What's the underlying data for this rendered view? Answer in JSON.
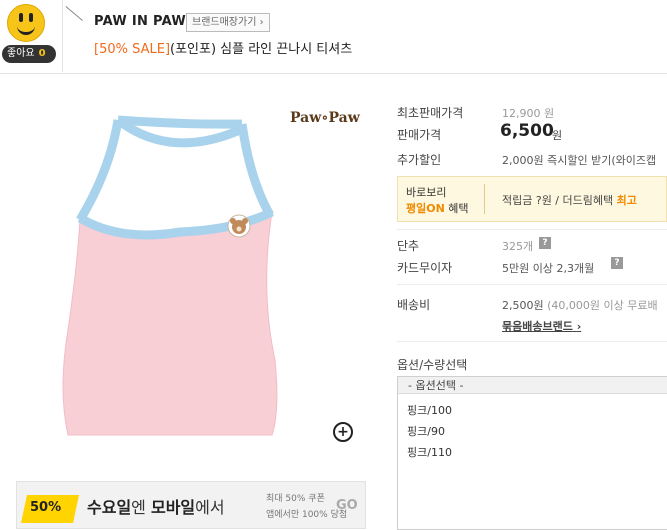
{
  "header": {
    "like_label": "좋아요",
    "like_count": "0",
    "brand": "PAW IN PAW",
    "brand_store_button": "브랜드매장가기 ›",
    "title_sale": "[50% SALE]",
    "title_rest": "(포인포) 심플 라인 끈나시 티셔츠"
  },
  "product_image": {
    "logo_text": "Paw∘Paw",
    "zoom_icon": "+"
  },
  "banner": {
    "tag": "50%",
    "main_pre": "수요일",
    "main_mid": "엔 ",
    "main_bold": "모바일",
    "main_post": "에서",
    "sub1": "최대 50% 쿠폰",
    "sub2": "앱에서만 100% 당첨",
    "go": "GO"
  },
  "info": {
    "first_price_label": "최초판매가격",
    "first_price_value": "12,900 원",
    "price_label": "판매가격",
    "price_value": "6,500",
    "price_unit": "원",
    "extra_discount_label": "추가할인",
    "extra_discount_value": "2,000원 즉시할인 받기(와이즈캡",
    "promo_line1": "바로보리",
    "promo_on": "평일ON",
    "promo_on_suffix": " 혜택",
    "promo_right_pre": "적립금 ?원 / 더드림혜택 ",
    "promo_right_hl": "최고",
    "unit_label": "단추",
    "unit_value": "325개",
    "card_label": "카드무이자",
    "card_value": "5만원 이상 2,3개월",
    "shipping_label": "배송비",
    "shipping_value": "2,500원",
    "shipping_note": "(40,000원 이상 무료배",
    "bundle_brand": "묶음배송브랜드",
    "bundle_arrow": "›"
  },
  "options": {
    "title": "옵션/수량선택",
    "header": "- 옵션선택 -",
    "items": [
      "핑크/100",
      "핑크/90",
      "핑크/110"
    ]
  },
  "colors": {
    "sale": "#f26b1d",
    "promo_orange": "#f08a00",
    "shirt_pink": "#f9cfd6",
    "trim_blue": "#a9d3ec"
  }
}
